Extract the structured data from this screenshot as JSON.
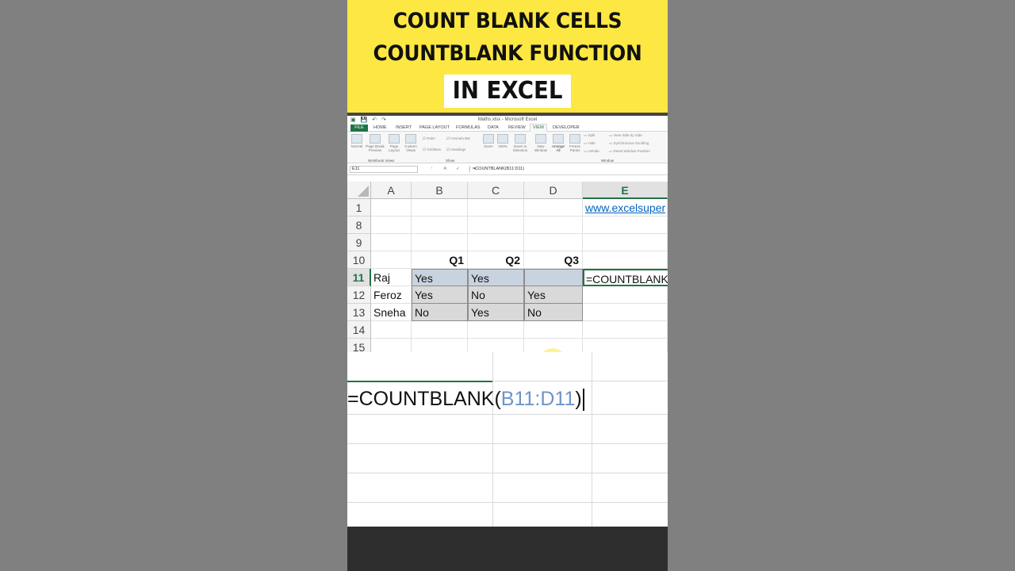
{
  "banner": {
    "line1": "COUNT BLANK CELLS",
    "line2": "COUNTBLANK FUNCTION",
    "line3": "IN EXCEL",
    "background": "#fde843"
  },
  "excel": {
    "window_title": "Maths.xlsx - Microsoft Excel",
    "tabs": [
      "FILE",
      "HOME",
      "INSERT",
      "PAGE LAYOUT",
      "FORMULAS",
      "DATA",
      "REVIEW",
      "VIEW",
      "DEVELOPER"
    ],
    "active_tab": "VIEW",
    "ribbon": {
      "workbook_views": [
        "Normal",
        "Page Break Preview",
        "Page Layout",
        "Custom Views"
      ],
      "show": [
        "Ruler",
        "Formula Bar",
        "Gridlines",
        "Headings"
      ],
      "zoom": [
        "Zoom",
        "100%",
        "Zoom to Selection"
      ],
      "window": [
        "New Window",
        "Arrange All",
        "Freeze Panes"
      ],
      "window_small": [
        "Split",
        "Hide",
        "Unhide"
      ],
      "window_side": [
        "View Side by Side",
        "Synchronous Scrolling",
        "Reset Window Position"
      ],
      "group_labels": [
        "Workbook Views",
        "Show",
        "Window"
      ]
    },
    "name_box": "E11",
    "formula_bar": "=COUNTBLANK(B11:D11)",
    "column_headers": [
      "A",
      "B",
      "C",
      "D",
      "E"
    ],
    "selected_column": "E",
    "rows": [
      {
        "num": "1",
        "A": "",
        "B": "",
        "C": "",
        "D": "",
        "E": "www.excelsuper"
      },
      {
        "num": "8",
        "A": "",
        "B": "",
        "C": "",
        "D": "",
        "E": ""
      },
      {
        "num": "9",
        "A": "",
        "B": "",
        "C": "",
        "D": "",
        "E": ""
      },
      {
        "num": "10",
        "A": "",
        "B": "Q1",
        "C": "Q2",
        "D": "Q3",
        "E": ""
      },
      {
        "num": "11",
        "A": "Raj",
        "B": "Yes",
        "C": "Yes",
        "D": "",
        "E": "=COUNTBLANK("
      },
      {
        "num": "12",
        "A": "Feroz",
        "B": "Yes",
        "C": "No",
        "D": "Yes",
        "E": ""
      },
      {
        "num": "13",
        "A": "Sneha",
        "B": "No",
        "C": "Yes",
        "D": "No",
        "E": ""
      },
      {
        "num": "14",
        "A": "",
        "B": "",
        "C": "",
        "D": "",
        "E": ""
      },
      {
        "num": "15",
        "A": "",
        "B": "",
        "C": "",
        "D": "",
        "E": ""
      }
    ],
    "selected_row": "11",
    "accent_color": "#217346"
  },
  "zoom_panel": {
    "formula_prefix": "=COUNTBLANK(",
    "formula_ref": "B11:D11",
    "formula_suffix": ")",
    "ref_color": "#6f93c8"
  }
}
